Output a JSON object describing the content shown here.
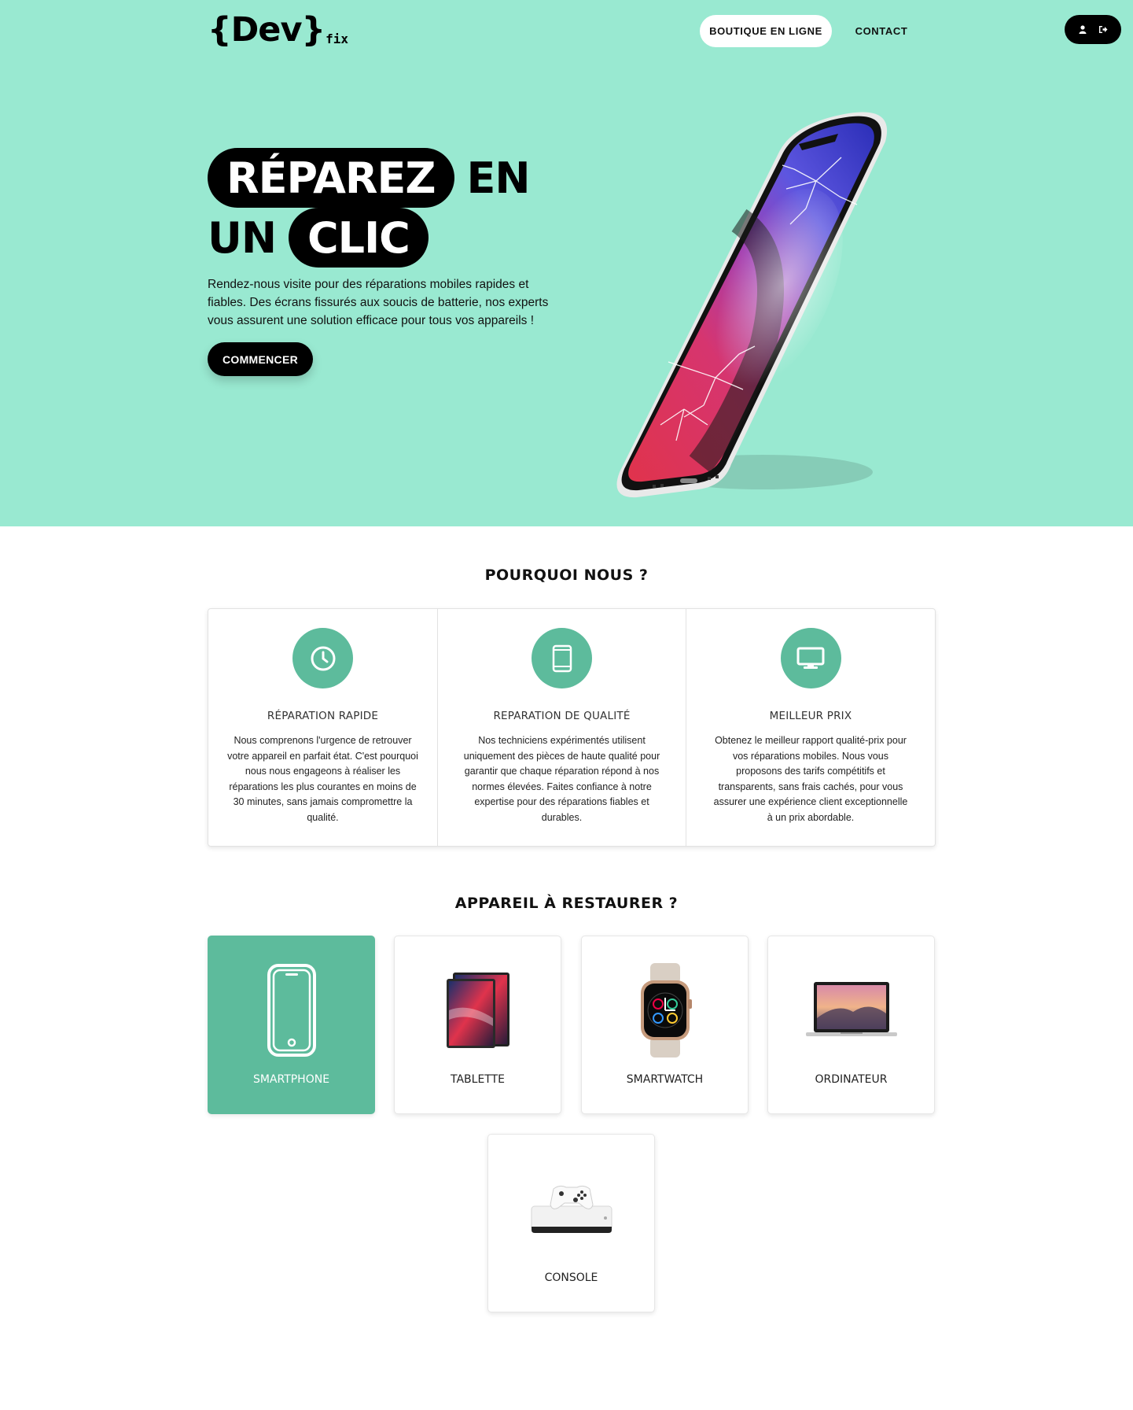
{
  "brand": {
    "logo_main": "{Dev}",
    "logo_sub": "fix"
  },
  "nav": {
    "shop_label": "BOUTIQUE EN LIGNE",
    "contact_label": "CONTACT",
    "user_icon": "user-icon",
    "logout_icon": "logout-icon"
  },
  "hero": {
    "title_pill_1": "RÉPAREZ",
    "title_word_1": "EN",
    "title_word_2": "UN",
    "title_pill_2": "CLIC",
    "description": "Rendez-nous visite pour des réparations mobiles rapides et fiables. Des écrans fissurés aux soucis de batterie, nos experts vous assurent une solution efficace pour tous vos appareils !",
    "cta_label": "COMMENCER"
  },
  "why": {
    "title": "POURQUOI NOUS ?",
    "cards": [
      {
        "icon": "clock-icon",
        "title": "RÉPARATION RAPIDE",
        "text": "Nous comprenons l'urgence de retrouver votre appareil en parfait état. C'est pourquoi nous nous engageons à réaliser les réparations les plus courantes en moins de 30 minutes, sans jamais compromettre la qualité."
      },
      {
        "icon": "mobile-icon",
        "title": "REPARATION DE QUALITÉ",
        "text": "Nos techniciens expérimentés utilisent uniquement des pièces de haute qualité pour garantir que chaque réparation répond à nos normes élevées. Faites confiance à notre expertise pour des réparations fiables et durables."
      },
      {
        "icon": "desktop-icon",
        "title": "MEILLEUR PRIX",
        "text": "Obtenez le meilleur rapport qualité-prix pour vos réparations mobiles. Nous vous proposons des tarifs compétitifs et transparents, sans frais cachés, pour vous assurer une expérience client exceptionnelle à un prix abordable."
      }
    ]
  },
  "devices": {
    "title": "APPAREIL À RESTAURER ?",
    "items": [
      {
        "label": "SMARTPHONE",
        "icon": "smartphone-icon",
        "active": true
      },
      {
        "label": "TABLETTE",
        "icon": "tablet-icon",
        "active": false
      },
      {
        "label": "SMARTWATCH",
        "icon": "smartwatch-icon",
        "active": false
      },
      {
        "label": "ORDINATEUR",
        "icon": "laptop-icon",
        "active": false
      },
      {
        "label": "CONSOLE",
        "icon": "console-icon",
        "active": false
      }
    ]
  },
  "colors": {
    "hero_bg": "#99e9d1",
    "accent": "#5dbb9c",
    "dark": "#000000"
  }
}
